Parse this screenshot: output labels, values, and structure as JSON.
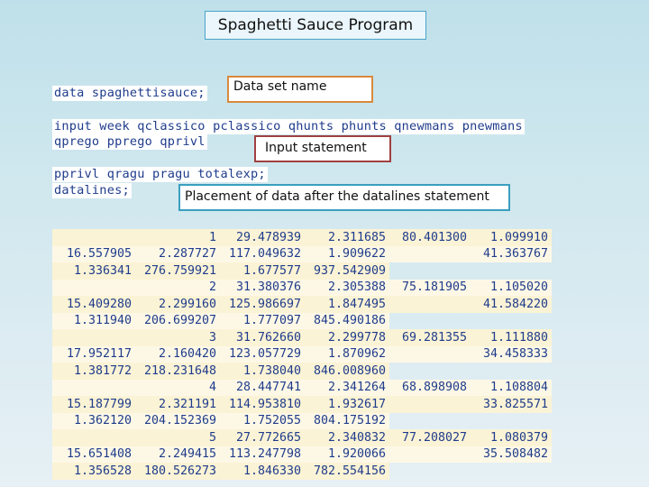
{
  "title": "Spaghetti Sauce Program",
  "code": {
    "line1": "data spaghettisauce;",
    "line2": "input week qclassico pclassico qhunts phunts qnewmans pnewmans",
    "line3": "qprego pprego qprivl",
    "line4": "pprivl qragu pragu totalexp;",
    "line5": "datalines;"
  },
  "callouts": {
    "dataset": "Data set name",
    "input": "Input statement",
    "datalines": "Placement of data after the datalines statement"
  },
  "data_rows": [
    [
      "",
      "1",
      "29.478939",
      "2.311685",
      "80.401300",
      "1.099910"
    ],
    [
      "16.557905",
      "2.287727",
      "117.049632",
      "1.909622",
      "",
      "41.363767"
    ],
    [
      "1.336341",
      "276.759921",
      "1.677577",
      "937.542909",
      "",
      ""
    ],
    [
      "",
      "2",
      "31.380376",
      "2.305388",
      "75.181905",
      "1.105020"
    ],
    [
      "15.409280",
      "2.299160",
      "125.986697",
      "1.847495",
      "",
      "41.584220"
    ],
    [
      "1.311940",
      "206.699207",
      "1.777097",
      "845.490186",
      "",
      ""
    ],
    [
      "",
      "3",
      "31.762660",
      "2.299778",
      "69.281355",
      "1.111880"
    ],
    [
      "17.952117",
      "2.160420",
      "123.057729",
      "1.870962",
      "",
      "34.458333"
    ],
    [
      "1.381772",
      "218.231648",
      "1.738040",
      "846.008960",
      "",
      ""
    ],
    [
      "",
      "4",
      "28.447741",
      "2.341264",
      "68.898908",
      "1.108804"
    ],
    [
      "15.187799",
      "2.321191",
      "114.953810",
      "1.932617",
      "",
      "33.825571"
    ],
    [
      "1.362120",
      "204.152369",
      "1.752055",
      "804.175192",
      "",
      ""
    ],
    [
      "",
      "5",
      "27.772665",
      "2.340832",
      "77.208027",
      "1.080379"
    ],
    [
      "15.651408",
      "2.249415",
      "113.247798",
      "1.920066",
      "",
      "35.508482"
    ],
    [
      "1.356528",
      "180.526273",
      "1.846330",
      "782.554156",
      "",
      ""
    ]
  ]
}
